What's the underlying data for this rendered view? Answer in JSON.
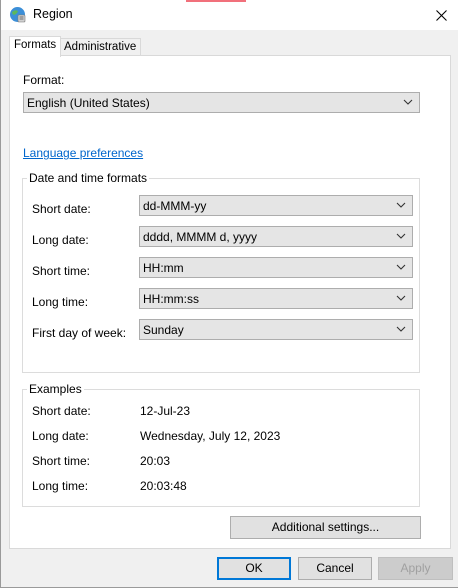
{
  "window": {
    "title": "Region"
  },
  "tabs": [
    {
      "label": "Formats",
      "active": true
    },
    {
      "label": "Administrative",
      "active": false
    }
  ],
  "format": {
    "label": "Format:",
    "value": "English (United States)"
  },
  "language_link": "Language preferences",
  "date_time_formats": {
    "title": "Date and time formats",
    "rows": [
      {
        "label": "Short date:",
        "value": "dd-MMM-yy"
      },
      {
        "label": "Long date:",
        "value": "dddd, MMMM d, yyyy"
      },
      {
        "label": "Short time:",
        "value": "HH:mm"
      },
      {
        "label": "Long time:",
        "value": "HH:mm:ss"
      },
      {
        "label": "First day of week:",
        "value": "Sunday"
      }
    ]
  },
  "examples": {
    "title": "Examples",
    "rows": [
      {
        "label": "Short date:",
        "value": "12-Jul-23"
      },
      {
        "label": "Long date:",
        "value": "Wednesday, July 12, 2023"
      },
      {
        "label": "Short time:",
        "value": "20:03"
      },
      {
        "label": "Long time:",
        "value": "20:03:48"
      }
    ]
  },
  "buttons": {
    "additional": "Additional settings...",
    "ok": "OK",
    "cancel": "Cancel",
    "apply": "Apply"
  }
}
